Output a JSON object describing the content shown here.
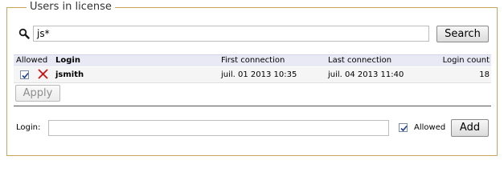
{
  "panel": {
    "legend": "Users in license"
  },
  "search": {
    "value": "js*",
    "button_label": "Search"
  },
  "table": {
    "headers": {
      "allowed": "Allowed",
      "login": "Login",
      "first_connection": "First connection",
      "last_connection": "Last connection",
      "login_count": "Login count"
    },
    "rows": [
      {
        "allowed": true,
        "login": "jsmith",
        "first_connection": "juil. 01 2013 10:35",
        "last_connection": "juil. 04 2013 11:40",
        "login_count": "18"
      }
    ]
  },
  "apply_label": "Apply",
  "add_form": {
    "login_label": "Login:",
    "login_value": "",
    "allowed_label": "Allowed",
    "allowed_checked": true,
    "add_label": "Add"
  },
  "colors": {
    "fieldset_border": "#c9a45e",
    "header_bg": "#e9e9f6",
    "delete_red": "#cc1111"
  }
}
